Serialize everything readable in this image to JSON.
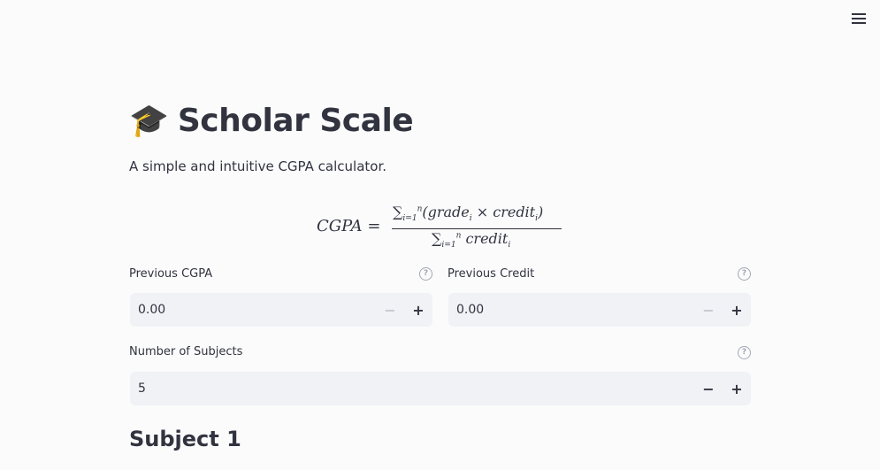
{
  "app": {
    "title": "Scholar Scale",
    "title_icon": "graduation-cap-icon",
    "subtitle": "A simple and intuitive CGPA calculator."
  },
  "formula": {
    "lhs": "CGPA =",
    "numerator": "∑(grade × credit)",
    "denominator": "∑ credit",
    "sum_lower": "i=1",
    "sum_upper": "n",
    "index": "i"
  },
  "fields": {
    "previous_cgpa": {
      "label": "Previous CGPA",
      "value": "0.00",
      "help_icon": "question-circle-icon"
    },
    "previous_credit": {
      "label": "Previous Credit",
      "value": "0.00",
      "help_icon": "question-circle-icon"
    },
    "number_of_subjects": {
      "label": "Number of Subjects",
      "value": "5",
      "help_icon": "question-circle-icon"
    }
  },
  "stepper": {
    "minus": "−",
    "plus": "+"
  },
  "help_glyph": "?",
  "sections": {
    "subject_1_header": "Subject 1"
  },
  "menu_icon": "hamburger-menu-icon"
}
